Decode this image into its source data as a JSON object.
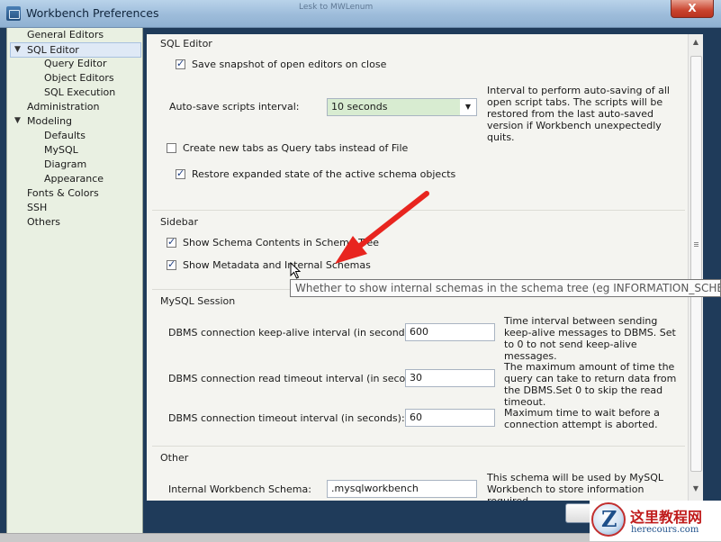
{
  "window": {
    "title": "Workbench Preferences",
    "blurred_title": "Lesk to MWLenum",
    "close_label": "X"
  },
  "sidebar": {
    "items": [
      {
        "label": "General Editors"
      },
      {
        "label": "SQL Editor"
      },
      {
        "label": "Query Editor"
      },
      {
        "label": "Object Editors"
      },
      {
        "label": "SQL Execution"
      },
      {
        "label": "Administration"
      },
      {
        "label": "Modeling"
      },
      {
        "label": "Defaults"
      },
      {
        "label": "MySQL"
      },
      {
        "label": "Diagram"
      },
      {
        "label": "Appearance"
      },
      {
        "label": "Fonts & Colors"
      },
      {
        "label": "SSH"
      },
      {
        "label": "Others"
      }
    ],
    "selected": "SQL Editor"
  },
  "sql_editor": {
    "title": "SQL Editor",
    "save_snapshot": {
      "label": "Save snapshot of open editors on close",
      "checked": true
    },
    "autosave": {
      "label": "Auto-save scripts interval:",
      "value": "10 seconds",
      "description": "Interval to perform auto-saving of all open script tabs. The scripts will be restored from the last auto-saved version if Workbench unexpectedly quits."
    },
    "create_tabs": {
      "label": "Create new tabs as Query tabs instead of File",
      "checked": false
    },
    "restore_state": {
      "label": "Restore expanded state of the active schema objects",
      "checked": true
    }
  },
  "sidebar_section": {
    "title": "Sidebar",
    "show_schema": {
      "label": "Show Schema Contents in Schema Tree",
      "checked": true
    },
    "show_metadata": {
      "label": "Show Metadata and Internal Schemas",
      "checked": true
    }
  },
  "mysql_session": {
    "title": "MySQL Session",
    "keepalive": {
      "label": "DBMS connection keep-alive interval (in seconds):",
      "value": "600",
      "description": "Time interval between sending keep-alive messages to DBMS. Set to 0 to not send keep-alive messages."
    },
    "read_timeout": {
      "label": "DBMS connection read timeout interval (in seconds):",
      "value": "30",
      "description": "The maximum amount of time the query can take to return data from the DBMS.Set 0 to skip the read timeout."
    },
    "conn_timeout": {
      "label": "DBMS connection timeout interval (in seconds):",
      "value": "60",
      "description": "Maximum time to wait before a connection attempt is aborted."
    }
  },
  "other": {
    "title": "Other",
    "schema": {
      "label": "Internal Workbench Schema:",
      "value": ".mysqlworkbench",
      "description": "This schema will be used by MySQL Workbench to store information required"
    }
  },
  "tooltip": "Whether to show internal schemas in the schema tree (eg INFORMATION_SCHEMA",
  "watermark": {
    "title": "这里教程网",
    "subtitle": "herecours.com",
    "logo_letter": "Z"
  },
  "colors": {
    "accent": "#d8ecd1",
    "annotation_arrow": "#e8251f",
    "frame": "#1f3b5a"
  }
}
